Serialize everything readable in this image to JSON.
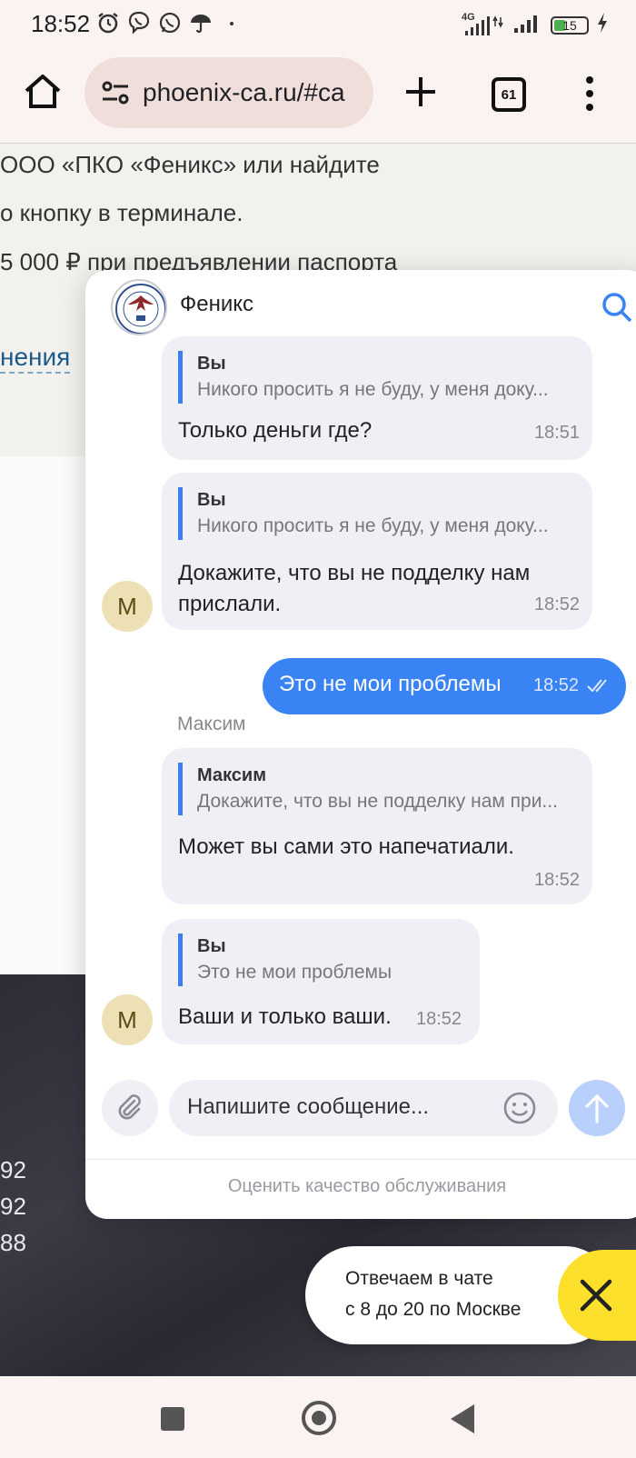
{
  "status_bar": {
    "time": "18:52",
    "network": "4G",
    "battery": "15"
  },
  "browser": {
    "url": "phoenix-ca.ru/#ca",
    "tab_count": "61"
  },
  "background_page": {
    "lines": [
      "ООО «ПКО «Феникс» или найдите",
      "о кнопку в терминале.",
      "5 000 ₽ при предъявлении паспорта"
    ],
    "link": "нения",
    "numbers": [
      "92",
      "92",
      "88"
    ]
  },
  "chat": {
    "title": "Феникс",
    "messages": [
      {
        "quote_name": "Вы",
        "quote_text": "Никого просить я не буду, у меня доку...",
        "text": "Только деньги где?",
        "time": "18:51"
      },
      {
        "quote_name": "Вы",
        "quote_text": "Никого просить я не буду, у меня доку...",
        "text_line1": "Докажите, что вы не подделку нам",
        "text_line2": "прислали.",
        "time": "18:52",
        "avatar": "М"
      },
      {
        "outgoing": true,
        "text": "Это не мои проблемы",
        "time": "18:52"
      },
      {
        "sender": "Максим",
        "quote_name": "Максим",
        "quote_text": "Докажите, что вы не подделку нам при...",
        "text": "Может вы сами это напечатиали.",
        "time": "18:52"
      },
      {
        "quote_name": "Вы",
        "quote_text": "Это не мои проблемы",
        "text": "Ваши и только ваши.",
        "time": "18:52",
        "avatar": "М"
      }
    ],
    "input_placeholder": "Напишите сообщение...",
    "rate_link": "Оценить качество обслуживания"
  },
  "hours_notice": {
    "line1": "Отвечаем в чате",
    "line2": "с 8 до 20 по Москве"
  },
  "colors": {
    "accent_blue": "#3a83f5",
    "close_yellow": "#fde02c"
  }
}
